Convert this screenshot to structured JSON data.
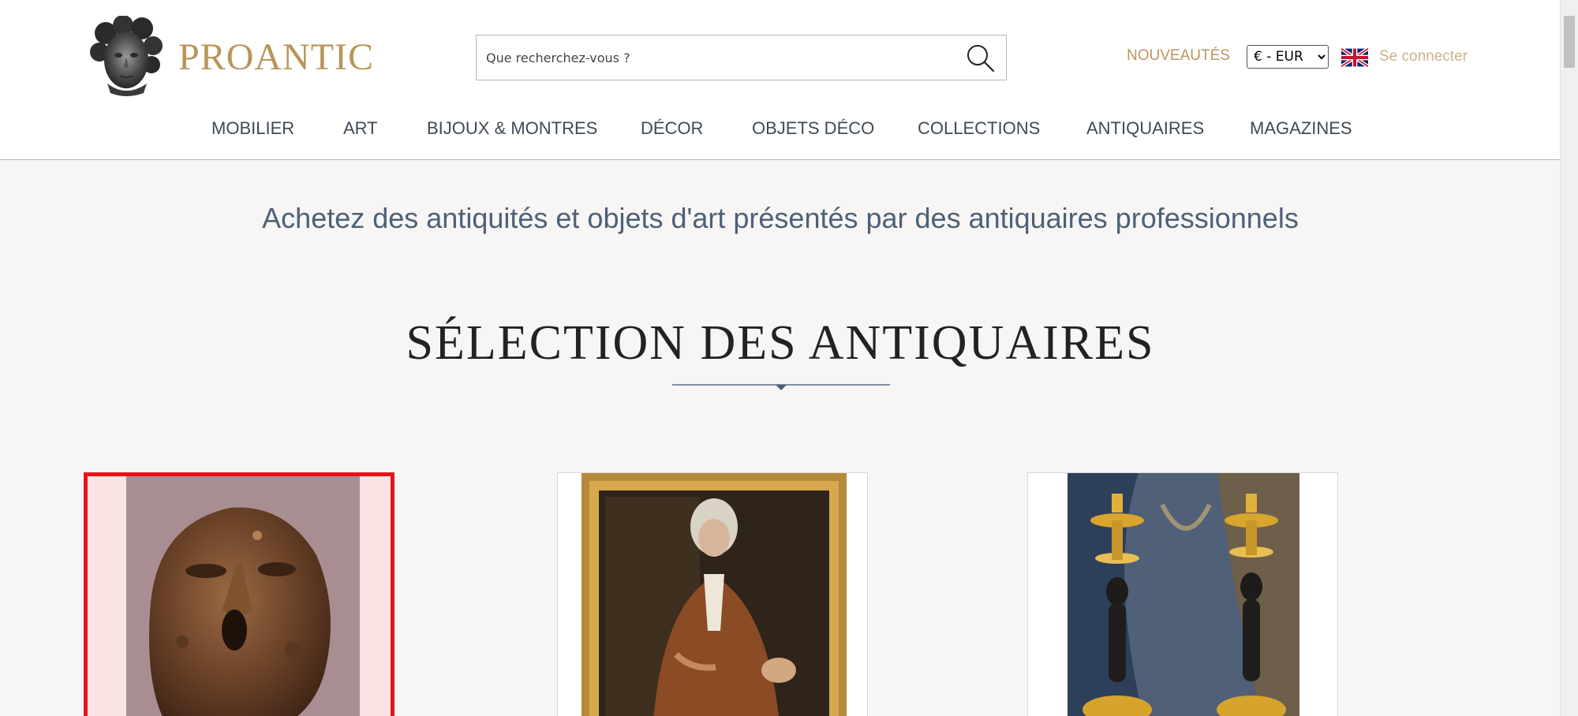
{
  "header": {
    "logo_text": "PROANTIC",
    "search_placeholder": "Que recherchez-vous ?",
    "nouveautes": "NOUVEAUTÉS",
    "currency": "€ - EUR",
    "login": "Se connecter"
  },
  "nav": {
    "items": [
      {
        "label": "MOBILIER"
      },
      {
        "label": "ART"
      },
      {
        "label": "BIJOUX & MONTRES"
      },
      {
        "label": "DÉCOR"
      },
      {
        "label": "OBJETS DÉCO"
      },
      {
        "label": "COLLECTIONS"
      },
      {
        "label": "ANTIQUAIRES"
      },
      {
        "label": "MAGAZINES"
      }
    ]
  },
  "main": {
    "tagline": "Achetez des antiquités et objets d'art présentés par des antiquaires professionnels",
    "section_title": "SÉLECTION DES ANTIQUAIRES"
  },
  "colors": {
    "brand_gold": "#b9955a",
    "nav_text": "#3f4a55",
    "tagline": "#4e6077",
    "selection_border": "#e8121a"
  }
}
